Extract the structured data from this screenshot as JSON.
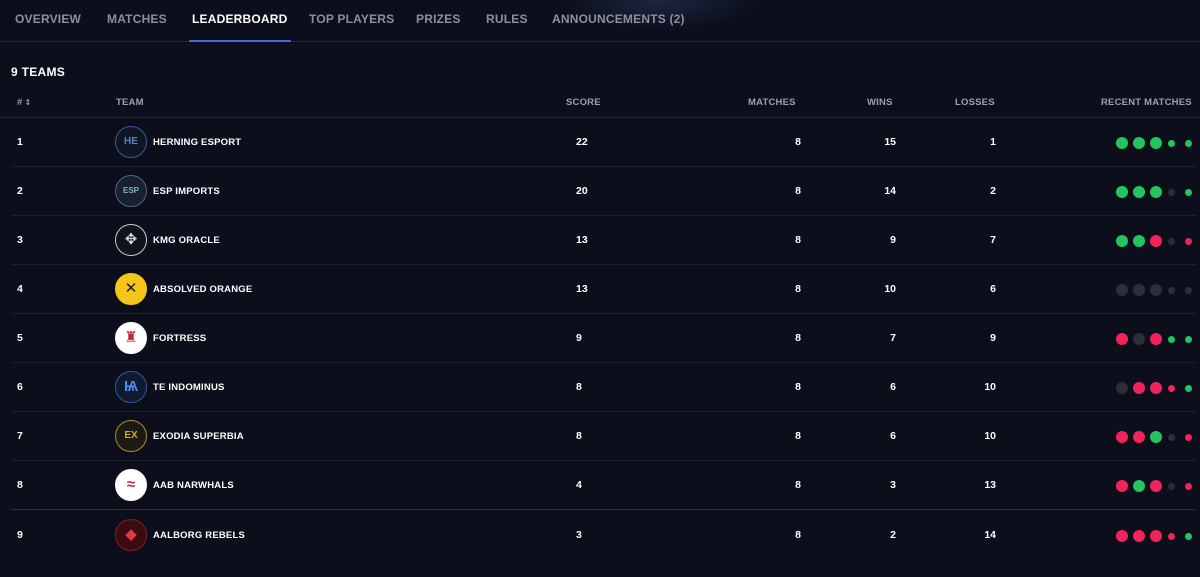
{
  "nav": {
    "tabs": [
      {
        "label": "OVERVIEW",
        "active": false
      },
      {
        "label": "MATCHES",
        "active": false
      },
      {
        "label": "LEADERBOARD",
        "active": true
      },
      {
        "label": "TOP PLAYERS",
        "active": false
      },
      {
        "label": "PRIZES",
        "active": false
      },
      {
        "label": "RULES",
        "active": false
      },
      {
        "label": "ANNOUNCEMENTS (2)",
        "active": false
      }
    ]
  },
  "teams_count": "9 TEAMS",
  "table": {
    "headers": {
      "rank": "#",
      "team": "TEAM",
      "score": "SCORE",
      "matches": "MATCHES",
      "wins": "WINS",
      "losses": "LOSSES",
      "recent": "RECENT MATCHES"
    },
    "rows": [
      {
        "rank": "1",
        "team": "HERNING ESPORT",
        "logo_icon": "herning-esport-logo",
        "score": "22",
        "matches": "8",
        "wins": "15",
        "losses": "1",
        "recent": [
          "win",
          "win",
          "win",
          "win",
          "win"
        ]
      },
      {
        "rank": "2",
        "team": "ESP IMPORTS",
        "logo_icon": "esp-imports-logo",
        "score": "20",
        "matches": "8",
        "wins": "14",
        "losses": "2",
        "recent": [
          "win",
          "win",
          "win",
          "none",
          "win"
        ]
      },
      {
        "rank": "3",
        "team": "KMG ORACLE",
        "logo_icon": "kmg-oracle-logo",
        "score": "13",
        "matches": "8",
        "wins": "9",
        "losses": "7",
        "recent": [
          "win",
          "win",
          "loss",
          "none",
          "loss"
        ]
      },
      {
        "rank": "4",
        "team": "ABSOLVED ORANGE",
        "logo_icon": "absolved-orange-logo",
        "score": "13",
        "matches": "8",
        "wins": "10",
        "losses": "6",
        "recent": [
          "none",
          "none",
          "none",
          "none",
          "none"
        ]
      },
      {
        "rank": "5",
        "team": "FORTRESS",
        "logo_icon": "fortress-logo",
        "score": "9",
        "matches": "8",
        "wins": "7",
        "losses": "9",
        "recent": [
          "loss",
          "none",
          "loss",
          "win",
          "win"
        ]
      },
      {
        "rank": "6",
        "team": "TE INDOMINUS",
        "logo_icon": "te-indominus-logo",
        "score": "8",
        "matches": "8",
        "wins": "6",
        "losses": "10",
        "recent": [
          "none",
          "loss",
          "loss",
          "loss",
          "win"
        ]
      },
      {
        "rank": "7",
        "team": "EXODIA SUPERBIA",
        "logo_icon": "exodia-superbia-logo",
        "score": "8",
        "matches": "8",
        "wins": "6",
        "losses": "10",
        "recent": [
          "loss",
          "loss",
          "win",
          "none",
          "loss"
        ]
      },
      {
        "rank": "8",
        "team": "AAB NARWHALS",
        "logo_icon": "aab-narwhals-logo",
        "score": "4",
        "matches": "8",
        "wins": "3",
        "losses": "13",
        "recent": [
          "loss",
          "win",
          "loss",
          "none",
          "loss"
        ]
      },
      {
        "rank": "9",
        "team": "AALBORG REBELS",
        "logo_icon": "aalborg-rebels-logo",
        "score": "3",
        "matches": "8",
        "wins": "2",
        "losses": "14",
        "recent": [
          "loss",
          "loss",
          "loss",
          "loss",
          "win"
        ]
      }
    ]
  },
  "colors": {
    "win": "#22c55e",
    "loss": "#f0245a",
    "none": "#2a2f3c",
    "accent": "#3d6fd6"
  }
}
